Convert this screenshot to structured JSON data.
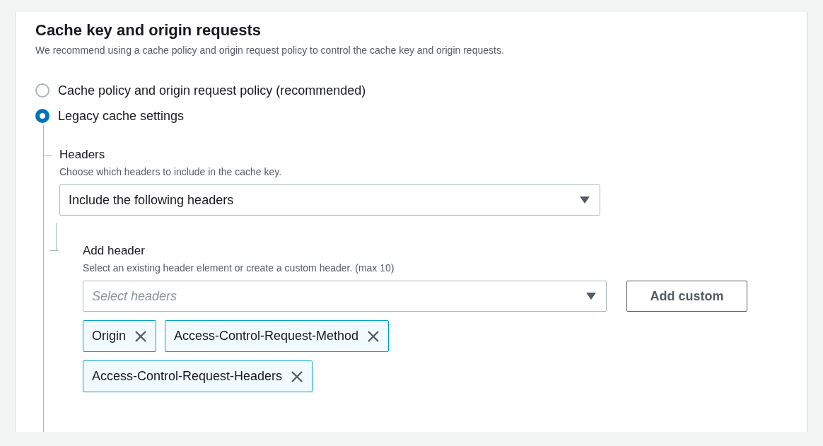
{
  "section": {
    "title": "Cache key and origin requests",
    "description": "We recommend using a cache policy and origin request policy to control the cache key and origin requests."
  },
  "options": [
    {
      "label": "Cache policy and origin request policy (recommended)",
      "selected": false
    },
    {
      "label": "Legacy cache settings",
      "selected": true
    }
  ],
  "headers": {
    "label": "Headers",
    "description": "Choose which headers to include in the cache key.",
    "value": "Include the following headers"
  },
  "add_header": {
    "label": "Add header",
    "description": "Select an existing header element or create a custom header. (max 10)",
    "placeholder": "Select headers",
    "button": "Add custom",
    "tokens": [
      {
        "label": "Origin"
      },
      {
        "label": "Access-Control-Request-Method"
      },
      {
        "label": "Access-Control-Request-Headers"
      }
    ]
  }
}
